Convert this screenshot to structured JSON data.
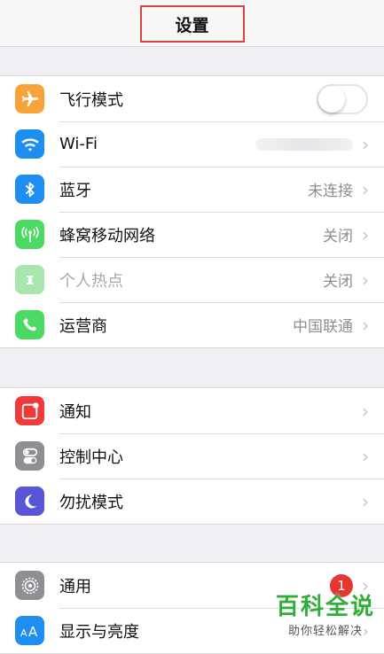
{
  "header": {
    "title": "设置"
  },
  "group1": [
    {
      "id": "airplane",
      "icon": "airplane-icon",
      "color": "#f7a33a",
      "label": "飞行模式",
      "control": "toggle",
      "toggle_on": false
    },
    {
      "id": "wifi",
      "icon": "wifi-icon",
      "color": "#1f8ef1",
      "label": "Wi-Fi",
      "value": "",
      "control": "chevron"
    },
    {
      "id": "bluetooth",
      "icon": "bluetooth-icon",
      "color": "#1f8ef1",
      "label": "蓝牙",
      "value": "未连接",
      "control": "chevron"
    },
    {
      "id": "cellular",
      "icon": "antenna-icon",
      "color": "#4cd964",
      "label": "蜂窝移动网络",
      "value": "关闭",
      "control": "chevron"
    },
    {
      "id": "hotspot",
      "icon": "hotspot-icon",
      "color": "#a8e6ae",
      "label": "个人热点",
      "value": "关闭",
      "control": "chevron",
      "disabled": true
    },
    {
      "id": "carrier",
      "icon": "phone-icon",
      "color": "#4cd964",
      "label": "运营商",
      "value": "中国联通",
      "control": "chevron"
    }
  ],
  "group2": [
    {
      "id": "notifications",
      "icon": "notification-icon",
      "color": "#f03a3a",
      "label": "通知"
    },
    {
      "id": "control_center",
      "icon": "switches-icon",
      "color": "#8e8e93",
      "label": "控制中心"
    },
    {
      "id": "do_not_disturb",
      "icon": "moon-icon",
      "color": "#5856d6",
      "label": "勿扰模式"
    }
  ],
  "group3": [
    {
      "id": "general",
      "icon": "gear-icon",
      "color": "#8e8e93",
      "label": "通用",
      "badge": "1"
    },
    {
      "id": "display",
      "icon": "text-size-icon",
      "color": "#1f8ef1",
      "label": "显示与亮度"
    }
  ],
  "watermark": {
    "title": "百科全说",
    "subtitle": "助你轻松解决"
  }
}
